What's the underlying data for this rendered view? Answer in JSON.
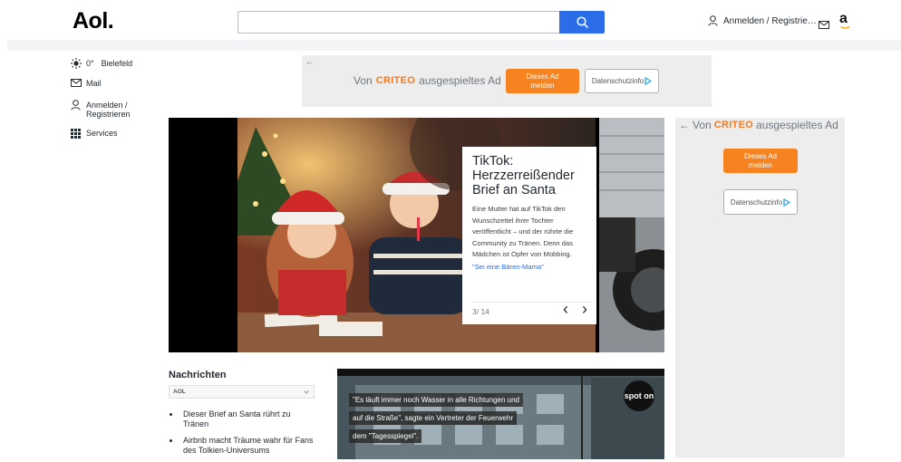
{
  "header": {
    "logo": "Aol.",
    "search_value": "",
    "signin_label": "Anmelden / Registrie…",
    "amazon_glyph": "a",
    "icons": [
      "search-icon",
      "user-icon",
      "mail-icon",
      "amazon-icon"
    ],
    "search_button_color": "#2b6de8"
  },
  "left_nav": {
    "weather_temp": "0°",
    "weather_city": "Bielefeld",
    "mail": "Mail",
    "signin": "Anmelden / Registrieren",
    "services": "Services"
  },
  "top_ad": {
    "back_arrow": "←",
    "prefix": "Von",
    "brand": "CRITEO",
    "suffix": "ausgespieltes Ad",
    "report_button": "Dieses Ad melden",
    "privacy_button": "Datenschutzinfo"
  },
  "side_ad": {
    "back_arrow": "←",
    "prefix": "Von",
    "brand": "CRITEO",
    "suffix": "ausgespieltes Ad",
    "report_button": "Dieses Ad melden",
    "privacy_button": "Datenschutzinfo"
  },
  "slider": {
    "title": "TikTok: Herzzerreißender Brief an Santa",
    "body": "Eine Mutter hat auf TikTok den Wunschzettel ihrer Tochter veröffentlicht – und der rührte die Community zu Tränen. Denn das Mädchen ist Opfer von Mobbing.",
    "link": "\"Sei eine Bären-Mama\"",
    "counter": "3/ 14",
    "prev": "‹",
    "next": "›"
  },
  "news": {
    "title": "Nachrichten",
    "source": "AOL",
    "items": [
      "Dieser Brief an Santa rührt zu Tränen",
      "Airbnb macht Träume wahr für Fans des Tolkien-Universums"
    ]
  },
  "video": {
    "caption_lines": [
      "\"Es läuft immer noch Wasser in alle Richtungen und",
      "auf die Straße\", sagte ein Vertreter der Feuerwehr",
      "dem \"Tagesspiegel\"."
    ],
    "badge": "spot on"
  },
  "colors": {
    "accent": "#2b6de8",
    "ad_orange": "#f68220",
    "ad_background": "#ededed"
  }
}
